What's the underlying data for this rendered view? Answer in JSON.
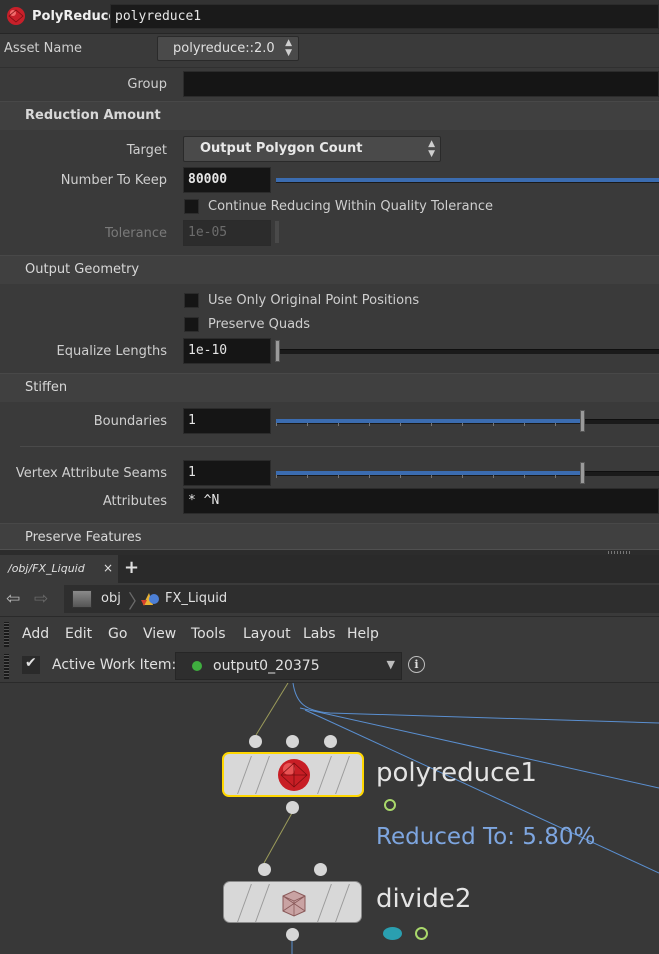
{
  "header": {
    "node_type": "PolyReduce",
    "node_name": "polyreduce1"
  },
  "asset": {
    "label": "Asset Name",
    "value": "polyreduce::2.0"
  },
  "group": {
    "label": "Group",
    "value": ""
  },
  "reduction": {
    "section_title": "Reduction Amount",
    "target_label": "Target",
    "target_value": "Output Polygon Count",
    "keep_label": "Number To Keep",
    "keep_value": "80000",
    "continue_label": "Continue Reducing Within Quality Tolerance",
    "tolerance_label": "Tolerance",
    "tolerance_value": "1e-05"
  },
  "output": {
    "section_title": "Output Geometry",
    "original_points_label": "Use Only Original Point Positions",
    "preserve_quads_label": "Preserve Quads",
    "equalize_label": "Equalize Lengths",
    "equalize_value": "1e-10"
  },
  "stiffen": {
    "section_title": "Stiffen",
    "boundaries_label": "Boundaries",
    "boundaries_value": "1",
    "boundaries_level": 0.8,
    "seams_label": "Vertex Attribute Seams",
    "seams_value": "1",
    "seams_level": 0.8,
    "attributes_label": "Attributes",
    "attributes_value": "* ^N"
  },
  "features": {
    "section_title": "Preserve Features"
  },
  "network": {
    "tab_label": "/obj/FX_Liquid",
    "tab_close": "×",
    "add_tab": "+",
    "path": [
      "obj",
      "FX_Liquid"
    ],
    "menu": [
      "Add",
      "Edit",
      "Go",
      "View",
      "Tools",
      "Layout",
      "Labs",
      "Help"
    ],
    "work_item_label": "Active Work Item:",
    "work_item_value": "output0_20375",
    "work_item_status_color": "#3fae3f",
    "nodes": [
      {
        "name": "polyreduce1",
        "icon": "red-sphere-icon",
        "badge": "Reduced To: 5.80%",
        "selected": true
      },
      {
        "name": "divide2",
        "icon": "wire-cube-icon",
        "badge": ""
      }
    ],
    "colors": {
      "accent": "#ffd700",
      "wire": "#5a8fd0",
      "badge_text": "#7ea6e0"
    }
  }
}
